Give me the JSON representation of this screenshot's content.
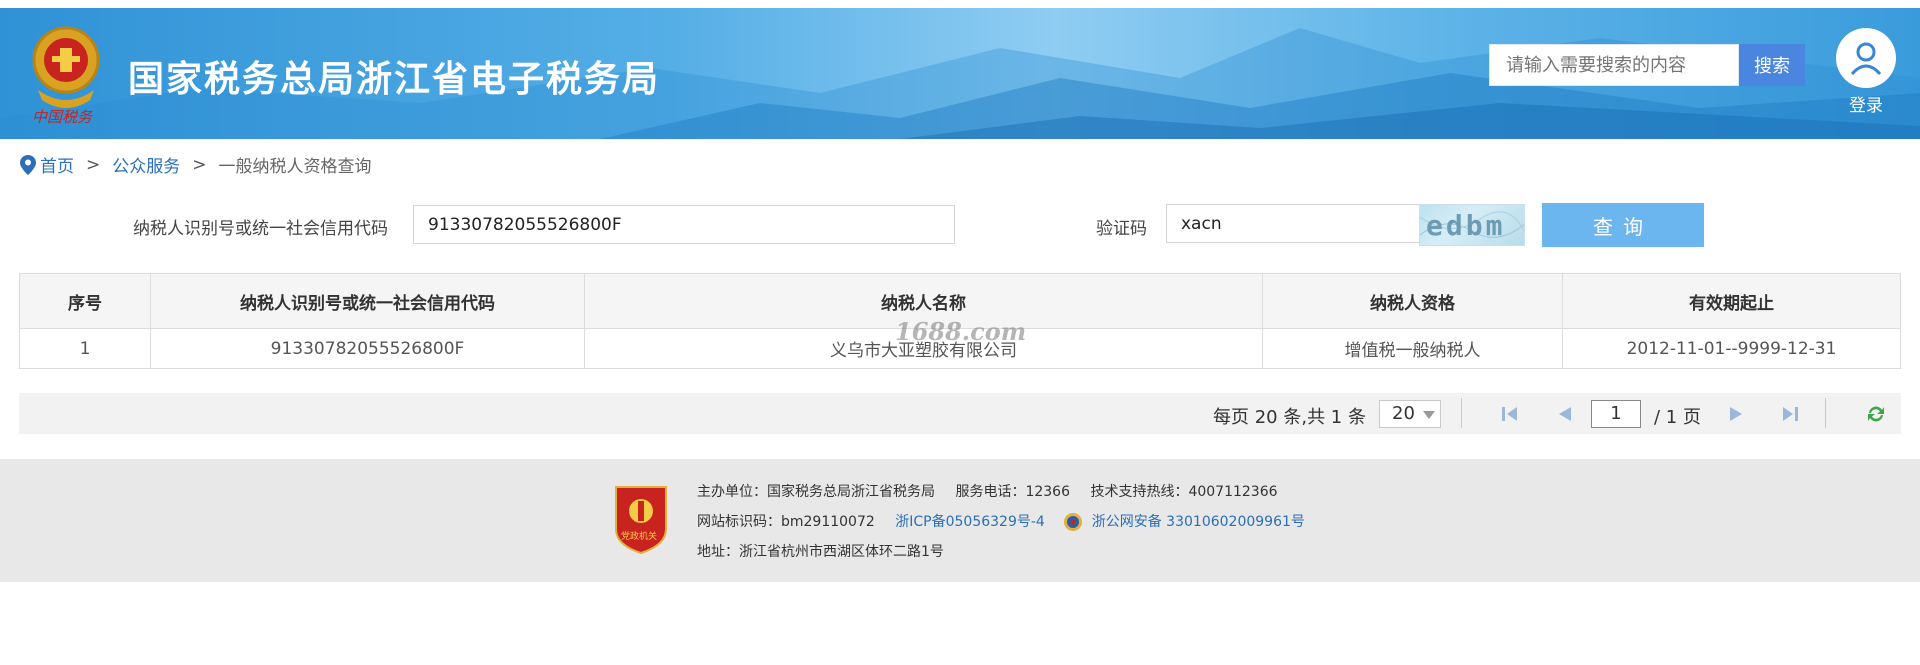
{
  "header": {
    "site_title": "国家税务总局浙江省电子税务局",
    "emblem_caption": "中国税务",
    "search_placeholder": "请输入需要搜索的内容",
    "search_button": "搜索",
    "login_label": "登录"
  },
  "breadcrumb": {
    "items": [
      "首页",
      "公众服务",
      "一般纳税人资格查询"
    ],
    "separator": ">"
  },
  "form": {
    "taxpayer_id_label": "纳税人识别号或统一社会信用代码",
    "taxpayer_id_value": "91330782055526800F",
    "captcha_label": "验证码",
    "captcha_value": "xacn",
    "captcha_image_text": "edbm",
    "query_button": "查询"
  },
  "table": {
    "headers": [
      "序号",
      "纳税人识别号或统一社会信用代码",
      "纳税人名称",
      "纳税人资格",
      "有效期起止"
    ],
    "rows": [
      [
        "1",
        "91330782055526800F",
        "义乌市大亚塑胶有限公司",
        "增值税一般纳税人",
        "2012-11-01--9999-12-31"
      ]
    ],
    "watermark": "1688.com"
  },
  "pager": {
    "summary": "每页 20 条,共 1 条",
    "page_size": "20",
    "current_page": "1",
    "total_pages": "/ 1 页"
  },
  "footer": {
    "sponsor": "主办单位：国家税务总局浙江省税务局",
    "service_phone": "服务电话：12366",
    "support_hotline": "技术支持热线：4007112366",
    "site_id": "网站标识码：bm29110072",
    "icp": "浙ICP备05056329号-4",
    "police": "浙公网安备 33010602009961号",
    "address": "地址：浙江省杭州市西湖区体环二路1号",
    "badge_caption": "党政机关"
  },
  "colors": {
    "header_blue": "#3a9bdc",
    "search_button": "#4a86e0",
    "query_button": "#6cb6ef",
    "link_blue": "#2a6fb7",
    "footer_bg": "#e8e8e8"
  }
}
